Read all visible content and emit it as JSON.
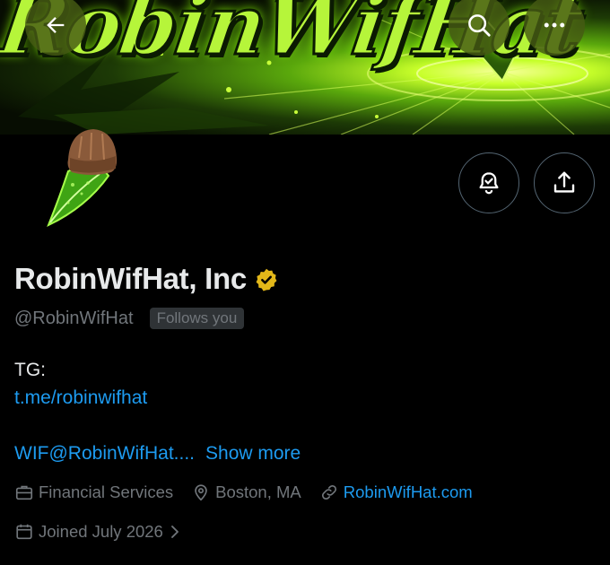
{
  "banner": {
    "title": "RobinWifHat"
  },
  "header": {
    "back_icon": "arrow-left-icon",
    "search_icon": "search-icon",
    "more_icon": "more-horizontal-icon"
  },
  "actions": {
    "notify_icon": "bell-check-icon",
    "share_icon": "share-upload-icon"
  },
  "profile": {
    "name": "RobinWifHat, Inc",
    "verified_color": "#e2b719",
    "handle": "@RobinWifHat",
    "follows_you": "Follows you",
    "bio_line1": "TG:",
    "bio_link": "t.me/robinwifhat",
    "email": "WIF@RobinWifHat....",
    "show_more": "Show more",
    "category": "Financial Services",
    "location": "Boston, MA",
    "website": "RobinWifHat.com",
    "joined": "Joined July 2026"
  },
  "colors": {
    "link": "#1d9bf0",
    "muted": "#71767b",
    "banner_accent": "#b6f53a"
  }
}
